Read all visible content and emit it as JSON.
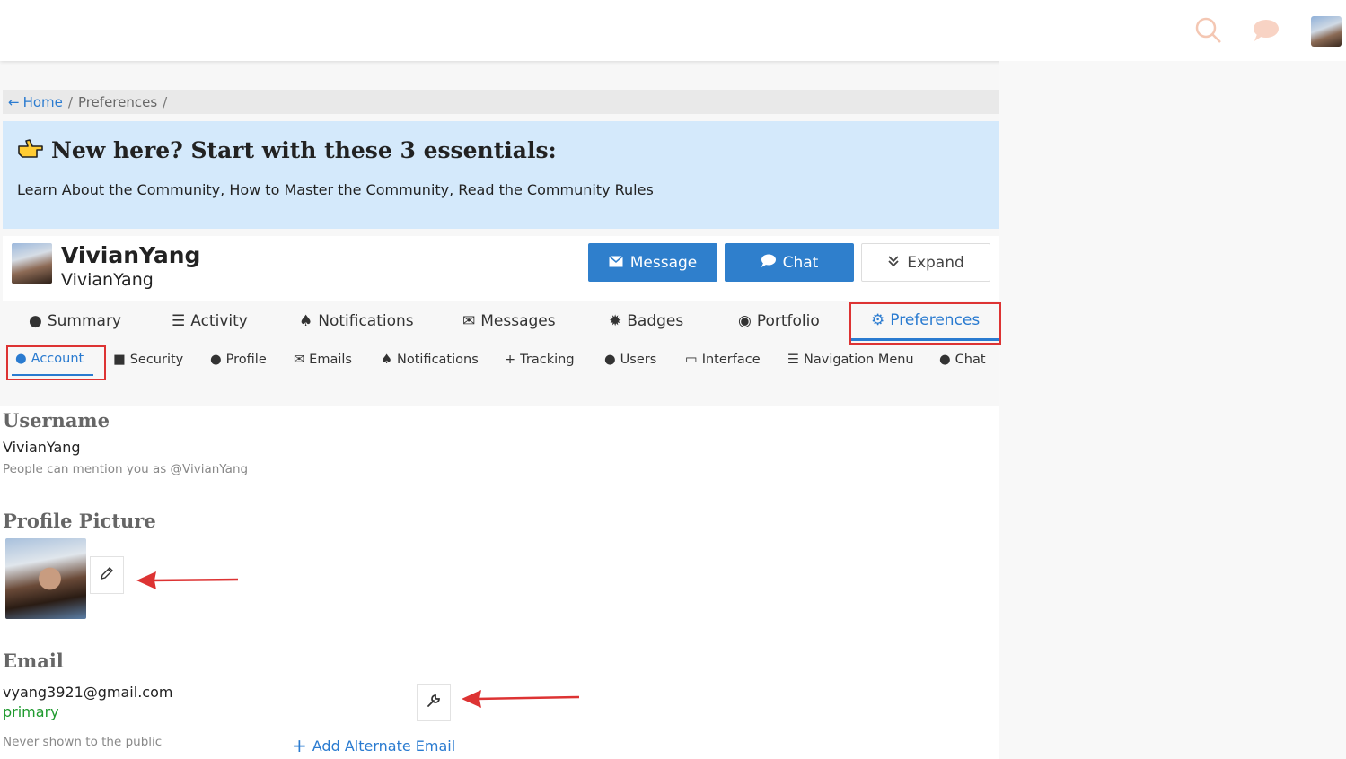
{
  "header": {
    "icons": [
      "search-icon",
      "chat-bubble-icon",
      "user-avatar"
    ],
    "accent_color": "#f4c7b3"
  },
  "breadcrumb": {
    "home": "Home",
    "current": "Preferences",
    "separator": "/"
  },
  "banner": {
    "title": "New here? Start with these 3 essentials:",
    "text": "Learn About the Community, How to Master the Community, Read the Community Rules",
    "background": "#d4e9fb"
  },
  "user": {
    "name": "VivianYang",
    "handle": "VivianYang",
    "buttons": {
      "message": "Message",
      "chat": "Chat",
      "expand": "Expand"
    }
  },
  "main_tabs": [
    {
      "label": "Summary",
      "icon": "user-icon"
    },
    {
      "label": "Activity",
      "icon": "list-icon"
    },
    {
      "label": "Notifications",
      "icon": "bell-icon"
    },
    {
      "label": "Messages",
      "icon": "envelope-icon"
    },
    {
      "label": "Badges",
      "icon": "badge-icon"
    },
    {
      "label": "Portfolio",
      "icon": "palette-icon"
    },
    {
      "label": "Preferences",
      "icon": "gear-icon",
      "active": true
    }
  ],
  "sub_tabs": [
    {
      "label": "Account",
      "icon": "user-icon",
      "active": true
    },
    {
      "label": "Security",
      "icon": "lock-icon"
    },
    {
      "label": "Profile",
      "icon": "user-icon"
    },
    {
      "label": "Emails",
      "icon": "envelope-icon"
    },
    {
      "label": "Notifications",
      "icon": "bell-icon"
    },
    {
      "label": "Tracking",
      "icon": "plus-icon"
    },
    {
      "label": "Users",
      "icon": "users-icon"
    },
    {
      "label": "Interface",
      "icon": "monitor-icon"
    },
    {
      "label": "Navigation Menu",
      "icon": "list-icon"
    },
    {
      "label": "Chat",
      "icon": "chat-bubble-icon"
    }
  ],
  "account": {
    "username_title": "Username",
    "username": "VivianYang",
    "username_hint": "People can mention you as @VivianYang",
    "picture_title": "Profile Picture",
    "email_title": "Email",
    "email": "vyang3921@gmail.com",
    "email_status": "primary",
    "email_hint": "Never shown to the public",
    "add_email": "Add Alternate Email"
  }
}
